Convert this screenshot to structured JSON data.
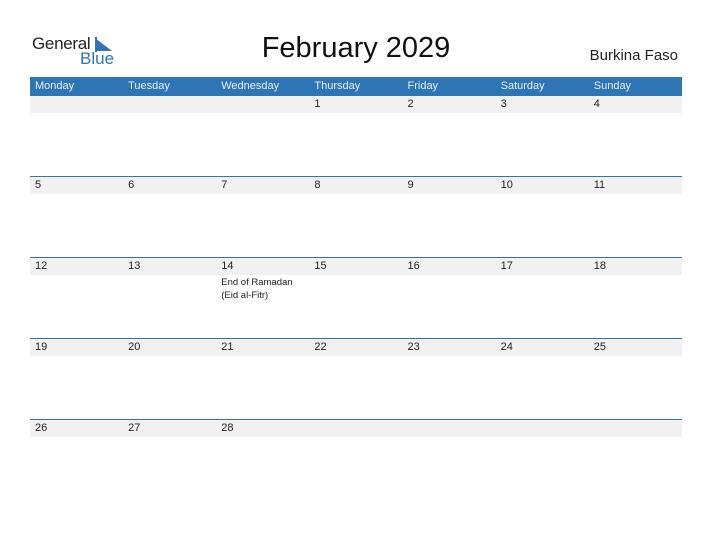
{
  "logo": {
    "word1": "General",
    "word2": "Blue"
  },
  "title": "February 2029",
  "country": "Burkina Faso",
  "colors": {
    "accent": "#2e75b6",
    "strip": "#f1f1f1"
  },
  "weekdays": [
    "Monday",
    "Tuesday",
    "Wednesday",
    "Thursday",
    "Friday",
    "Saturday",
    "Sunday"
  ],
  "weeks": [
    {
      "days": [
        {
          "n": "",
          "e": ""
        },
        {
          "n": "",
          "e": ""
        },
        {
          "n": "",
          "e": ""
        },
        {
          "n": "1",
          "e": ""
        },
        {
          "n": "2",
          "e": ""
        },
        {
          "n": "3",
          "e": ""
        },
        {
          "n": "4",
          "e": ""
        }
      ]
    },
    {
      "days": [
        {
          "n": "5",
          "e": ""
        },
        {
          "n": "6",
          "e": ""
        },
        {
          "n": "7",
          "e": ""
        },
        {
          "n": "8",
          "e": ""
        },
        {
          "n": "9",
          "e": ""
        },
        {
          "n": "10",
          "e": ""
        },
        {
          "n": "11",
          "e": ""
        }
      ]
    },
    {
      "days": [
        {
          "n": "12",
          "e": ""
        },
        {
          "n": "13",
          "e": ""
        },
        {
          "n": "14",
          "e": "End of Ramadan (Eid al-Fitr)"
        },
        {
          "n": "15",
          "e": ""
        },
        {
          "n": "16",
          "e": ""
        },
        {
          "n": "17",
          "e": ""
        },
        {
          "n": "18",
          "e": ""
        }
      ]
    },
    {
      "days": [
        {
          "n": "19",
          "e": ""
        },
        {
          "n": "20",
          "e": ""
        },
        {
          "n": "21",
          "e": ""
        },
        {
          "n": "22",
          "e": ""
        },
        {
          "n": "23",
          "e": ""
        },
        {
          "n": "24",
          "e": ""
        },
        {
          "n": "25",
          "e": ""
        }
      ]
    },
    {
      "days": [
        {
          "n": "26",
          "e": ""
        },
        {
          "n": "27",
          "e": ""
        },
        {
          "n": "28",
          "e": ""
        },
        {
          "n": "",
          "e": ""
        },
        {
          "n": "",
          "e": ""
        },
        {
          "n": "",
          "e": ""
        },
        {
          "n": "",
          "e": ""
        }
      ]
    }
  ]
}
